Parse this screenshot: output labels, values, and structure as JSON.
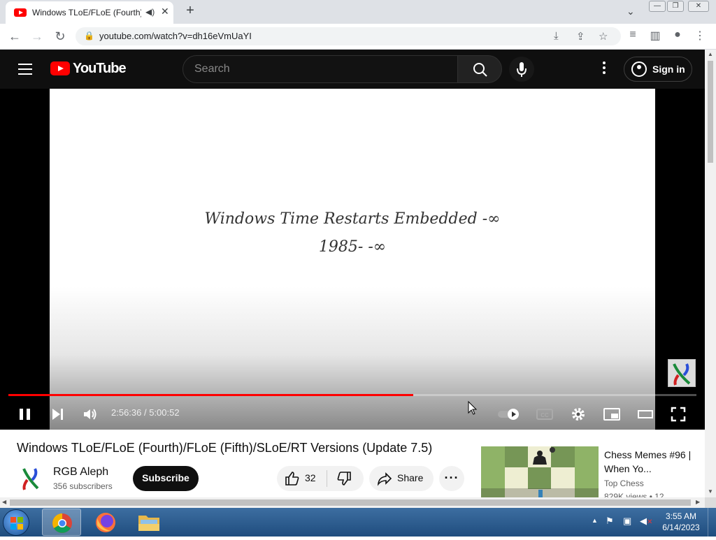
{
  "browser": {
    "tab_title": "Windows TLoE/FLoE (Fourth)",
    "url": "youtube.com/watch?v=dh16eVmUaYI"
  },
  "youtube": {
    "logo_text": "YouTube",
    "search_placeholder": "Search",
    "sign_in": "Sign in"
  },
  "player": {
    "screen_line1": "Windows Time Restarts Embedded -∞",
    "screen_line2": "1985- -∞",
    "time": "2:56:36 / 5:00:52",
    "progress": 0.588
  },
  "video": {
    "title": "Windows TLoE/FLoE (Fourth)/FLoE (Fifth)/SLoE/RT Versions (Update 7.5)",
    "channel": "RGB Aleph",
    "subscribers": "356 subscribers",
    "subscribe": "Subscribe",
    "likes": "32",
    "share": "Share"
  },
  "recommendation": {
    "title": "Chess Memes #96 | When Yo...",
    "channel": "Top Chess",
    "views": "829K views • 12"
  },
  "taskbar": {
    "time": "3:55 AM",
    "date": "6/14/2023"
  }
}
